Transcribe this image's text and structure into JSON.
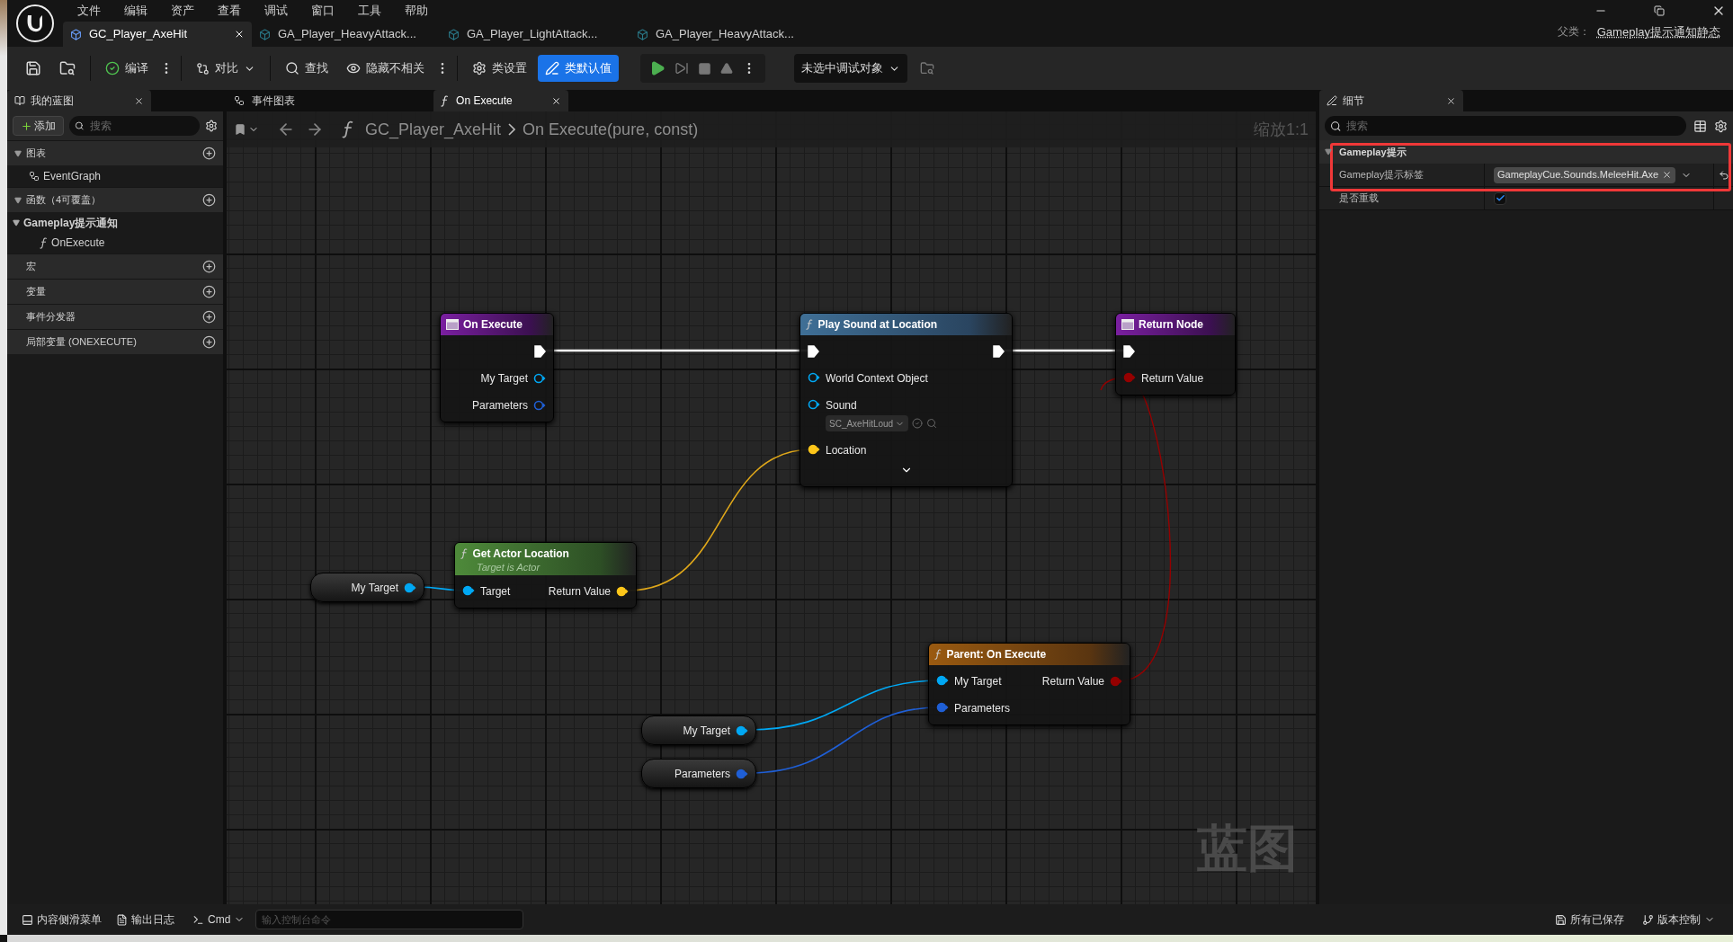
{
  "menu": [
    "文件",
    "编辑",
    "资产",
    "查看",
    "调试",
    "窗口",
    "工具",
    "帮助"
  ],
  "document_tabs": [
    {
      "label": "GC_Player_AxeHit",
      "selected": true
    },
    {
      "label": "GA_Player_HeavyAttack...",
      "selected": false
    },
    {
      "label": "GA_Player_LightAttack...",
      "selected": false
    },
    {
      "label": "GA_Player_HeavyAttack...",
      "selected": false
    }
  ],
  "parent_class": {
    "label": "父类：",
    "value": "Gameplay提示通知静态"
  },
  "toolbar": {
    "compile": "编译",
    "diff": "对比",
    "find": "查找",
    "hide_unrelated": "隐藏不相关",
    "class_settings": "类设置",
    "class_defaults": {
      "label": "类默认值",
      "selected": true
    },
    "debug_target": "未选中调试对象"
  },
  "my_blueprint": {
    "tab": "我的蓝图",
    "add": "添加",
    "search_placeholder": "搜索",
    "sections": [
      {
        "label": "图表",
        "expanded": true,
        "items": [
          {
            "label": "EventGraph",
            "kind": "graph"
          }
        ]
      },
      {
        "label": "函数（4可覆盖）",
        "expanded": true,
        "items": [
          {
            "label": "Gameplay提示通知",
            "kind": "category",
            "expanded": true,
            "children": [
              {
                "label": "OnExecute",
                "kind": "function"
              }
            ]
          }
        ]
      },
      {
        "label": "宏"
      },
      {
        "label": "变量"
      },
      {
        "label": "事件分发器"
      },
      {
        "label": "局部变量 (ONEXECUTE)"
      }
    ]
  },
  "graph_tabs": [
    {
      "label": "事件图表",
      "kind": "graph",
      "selected": false
    },
    {
      "label": "On Execute",
      "kind": "function",
      "selected": true
    }
  ],
  "breadcrumb": [
    "GC_Player_AxeHit",
    "On Execute(pure, const)"
  ],
  "zoom": "缩放1:1",
  "graph_label": "蓝图",
  "nodes": [
    {
      "kind": "entry",
      "title": "On Execute",
      "rows": [
        {
          "out": {
            "kind": "exec",
            "connected": true
          }
        },
        {
          "out": {
            "label": "My Target",
            "kind": "object",
            "connected": false
          }
        },
        {
          "out": {
            "label": "Parameters",
            "kind": "struct",
            "connected": false
          }
        }
      ]
    },
    {
      "kind": "call",
      "title": "Play Sound at Location",
      "expand": true,
      "rows": [
        {
          "in": {
            "kind": "exec",
            "connected": true
          },
          "out": {
            "kind": "exec",
            "connected": true
          }
        },
        {
          "in": {
            "label": "World Context Object",
            "kind": "object",
            "connected": false
          }
        },
        {
          "in": {
            "label": "Sound",
            "kind": "object",
            "connected": false,
            "default": "SC_AxeHitLoud"
          }
        },
        {
          "in": {
            "label": "Location",
            "kind": "vector",
            "connected": true
          }
        }
      ]
    },
    {
      "kind": "result",
      "title": "Return Node",
      "rows": [
        {
          "in": {
            "kind": "exec",
            "connected": true
          }
        },
        {
          "in": {
            "label": "Return Value",
            "kind": "bool",
            "connected": true
          }
        }
      ]
    },
    {
      "kind": "variable",
      "title": "My Target",
      "pin": {
        "kind": "object",
        "connected": true
      }
    },
    {
      "kind": "pure",
      "title": "Get Actor Location",
      "subtitle": "Target is Actor",
      "rows": [
        {
          "in": {
            "label": "Target",
            "kind": "object",
            "connected": true
          },
          "out": {
            "label": "Return Value",
            "kind": "vector",
            "connected": true
          }
        }
      ]
    },
    {
      "kind": "parent",
      "title": "Parent: On Execute",
      "rows": [
        {
          "in": {
            "label": "My Target",
            "kind": "object",
            "connected": true
          },
          "out": {
            "label": "Return Value",
            "kind": "bool",
            "connected": true
          }
        },
        {
          "in": {
            "label": "Parameters",
            "kind": "struct",
            "connected": true
          }
        }
      ]
    },
    {
      "kind": "variable",
      "title": "My Target",
      "pin": {
        "kind": "object",
        "connected": true
      }
    },
    {
      "kind": "variable",
      "title": "Parameters",
      "pin": {
        "kind": "struct",
        "connected": true
      }
    }
  ],
  "details": {
    "tab": "细节",
    "search_placeholder": "搜索",
    "category": {
      "label": "Gameplay提示",
      "expanded": true
    },
    "rows": [
      {
        "kind": "tag",
        "label": "Gameplay提示标签",
        "value": "GameplayCue.Sounds.MeleeHit.Axe"
      },
      {
        "kind": "checkbox",
        "label": "是否重载",
        "checked": true
      }
    ]
  },
  "status_bar": {
    "content_drawer": "内容侧滑菜单",
    "output_log": "输出日志",
    "cmd": "Cmd",
    "console_placeholder": "输入控制台命令",
    "saved": "所有已保存",
    "source_control": "版本控制"
  }
}
